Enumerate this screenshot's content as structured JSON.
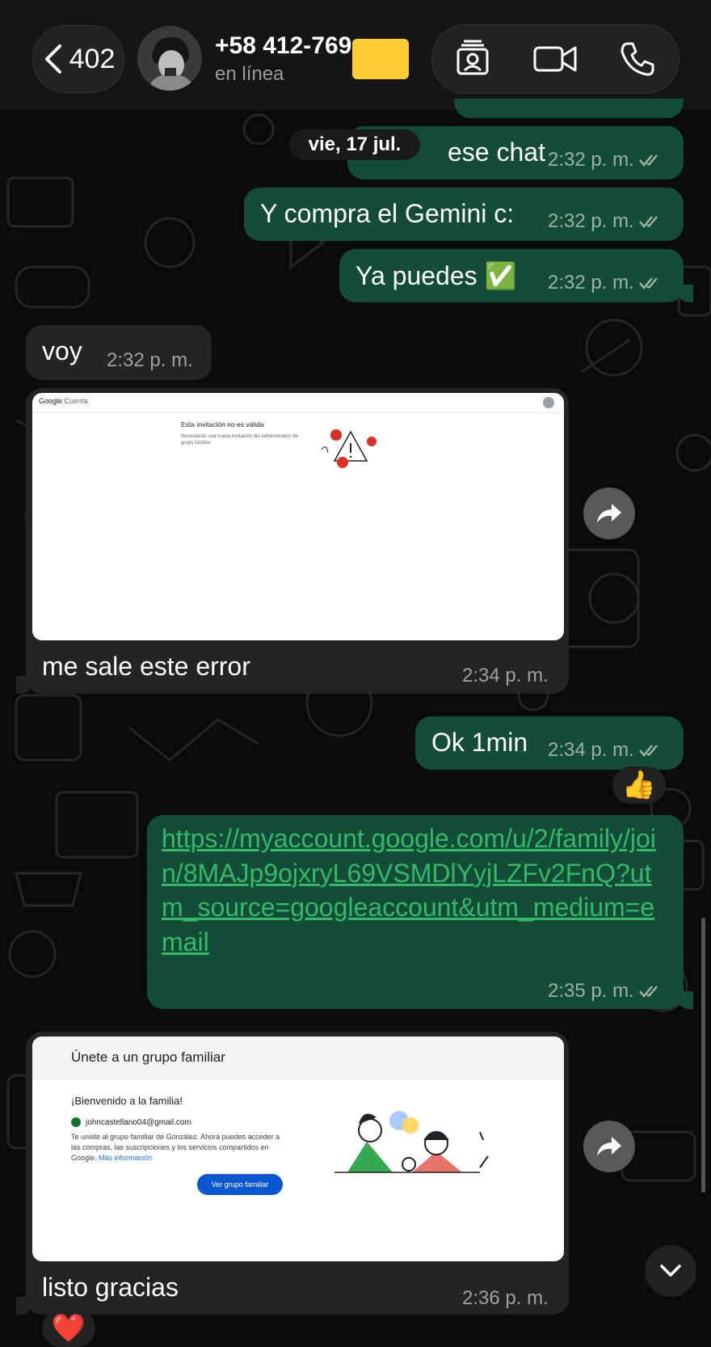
{
  "header": {
    "back_count": "402",
    "contact_name": "+58 412-769",
    "status": "en línea"
  },
  "date_separator": "vie, 17 jul.",
  "messages": [
    {
      "text": "ese chat",
      "time": "2:32 p. m."
    },
    {
      "text": "Y compra el Gemini c:",
      "time": "2:32 p. m."
    },
    {
      "text": "Ya puedes ✅",
      "time": "2:32 p. m."
    },
    {
      "text": "voy",
      "time": "2:32 p. m."
    },
    {
      "text": "me sale este error",
      "time": "2:34 p. m."
    },
    {
      "text": "Ok 1min",
      "time": "2:34 p. m.",
      "reaction": "👍"
    },
    {
      "text": "https://myaccount.google.com/u/2/family/join/8MAJp9ojxryL69VSMDlYyjLZFv2FnQ?utm_source=googleaccount&utm_medium=email",
      "time": "2:35 p. m."
    },
    {
      "text": "listo gracias",
      "time": "2:36 p. m.",
      "reaction": "❤️"
    }
  ],
  "shot1": {
    "brand": "Google",
    "brand_suffix": "Cuenta",
    "title": "Esta invitación no es válida",
    "body": "Necesitarás una nueva invitación del administrador del grupo familiar."
  },
  "shot2": {
    "heading": "Únete a un grupo familiar",
    "welcome": "¡Bienvenido a la familia!",
    "email": "johncastellano04@gmail.com",
    "body": "Te uniste al grupo familiar de González. Ahora puedes acceder a las compras, las suscripciones y los servicios compartidos en Google.",
    "link": "Más información",
    "button": "Ver grupo familiar"
  },
  "colors": {
    "outgoing": "#134d37",
    "incoming": "#242424",
    "link": "#35b86a",
    "redaction": "#ffcc33"
  }
}
